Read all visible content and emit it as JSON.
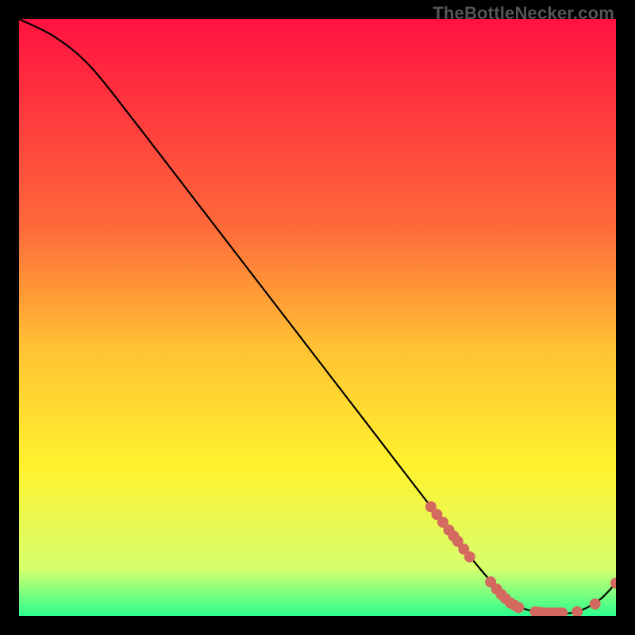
{
  "attribution": "TheBottleNecker.com",
  "chart_data": {
    "type": "line",
    "title": "",
    "xlabel": "",
    "ylabel": "",
    "xlim": [
      0,
      100
    ],
    "ylim": [
      0,
      100
    ],
    "gradient_stops": [
      {
        "offset": 0,
        "color": "#ff1240"
      },
      {
        "offset": 35,
        "color": "#ff6a3a"
      },
      {
        "offset": 55,
        "color": "#ffc233"
      },
      {
        "offset": 75,
        "color": "#fff22f"
      },
      {
        "offset": 92,
        "color": "#d7ff6d"
      },
      {
        "offset": 100,
        "color": "#2dff8e"
      }
    ],
    "series": [
      {
        "name": "curve",
        "points": [
          {
            "x": 0,
            "y": 100
          },
          {
            "x": 6,
            "y": 97
          },
          {
            "x": 12,
            "y": 92
          },
          {
            "x": 20,
            "y": 82
          },
          {
            "x": 30,
            "y": 69
          },
          {
            "x": 40,
            "y": 56
          },
          {
            "x": 50,
            "y": 43
          },
          {
            "x": 60,
            "y": 30
          },
          {
            "x": 70,
            "y": 17
          },
          {
            "x": 78,
            "y": 7
          },
          {
            "x": 83,
            "y": 2
          },
          {
            "x": 88,
            "y": 0.5
          },
          {
            "x": 93,
            "y": 0.6
          },
          {
            "x": 97,
            "y": 2.5
          },
          {
            "x": 100,
            "y": 5.5
          }
        ]
      }
    ],
    "markers": [
      {
        "x": 69,
        "y": 18.3
      },
      {
        "x": 70,
        "y": 17.0
      },
      {
        "x": 71,
        "y": 15.7
      },
      {
        "x": 72,
        "y": 14.4
      },
      {
        "x": 72.8,
        "y": 13.4
      },
      {
        "x": 73.5,
        "y": 12.5
      },
      {
        "x": 74.5,
        "y": 11.2
      },
      {
        "x": 75.5,
        "y": 9.9
      },
      {
        "x": 79,
        "y": 5.7
      },
      {
        "x": 80,
        "y": 4.5
      },
      {
        "x": 80.8,
        "y": 3.6
      },
      {
        "x": 81.5,
        "y": 2.9
      },
      {
        "x": 82.3,
        "y": 2.2
      },
      {
        "x": 83,
        "y": 1.8
      },
      {
        "x": 83.7,
        "y": 1.4
      },
      {
        "x": 86.5,
        "y": 0.7
      },
      {
        "x": 87.3,
        "y": 0.6
      },
      {
        "x": 88,
        "y": 0.5
      },
      {
        "x": 88.6,
        "y": 0.5
      },
      {
        "x": 89.3,
        "y": 0.5
      },
      {
        "x": 90,
        "y": 0.5
      },
      {
        "x": 90.5,
        "y": 0.5
      },
      {
        "x": 91,
        "y": 0.5
      },
      {
        "x": 93.5,
        "y": 0.7
      },
      {
        "x": 96.5,
        "y": 2.0
      },
      {
        "x": 100,
        "y": 5.5
      }
    ],
    "marker_color": "#d46a5f",
    "marker_radius": 7,
    "line_color": "#000000"
  }
}
